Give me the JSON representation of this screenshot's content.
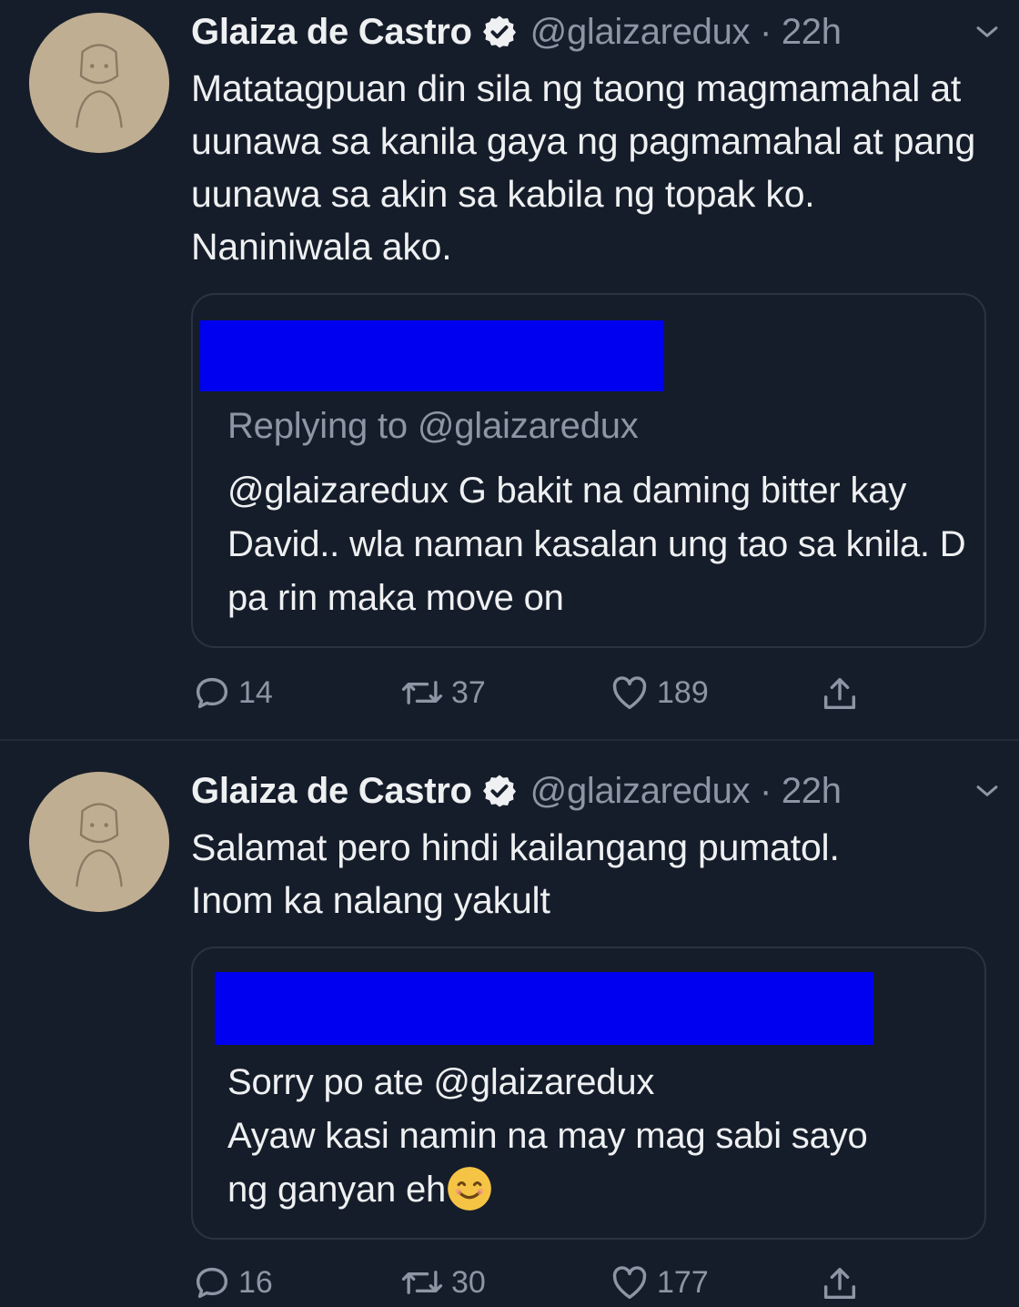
{
  "tweets": [
    {
      "name": "Glaiza de Castro",
      "handle": "@glaizaredux · 22h",
      "text": "Matatagpuan din sila ng taong magmamahal at uunawa sa kanila gaya ng pagmamahal at pang uunawa sa akin sa kabila ng topak ko. Naniniwala ako.",
      "quote": {
        "replying": "Replying to @glaizaredux",
        "text": "@glaizaredux  G bakit na daming bitter kay David.. wla naman kasalan ung tao sa knila. D pa rin maka move on"
      },
      "replies": "14",
      "retweets": "37",
      "likes": "189"
    },
    {
      "name": "Glaiza de Castro",
      "handle": "@glaizaredux · 22h",
      "text_line1": "Salamat pero hindi kailangang pumatol.",
      "text_line2": "Inom ka nalang yakult",
      "quote": {
        "line1": "Sorry po ate @glaizaredux",
        "line2": "Ayaw kasi namin na may mag sabi sayo",
        "line3": "ng ganyan eh",
        "emoji": "smiling-face-emoji"
      },
      "replies": "16",
      "retweets": "30",
      "likes": "177"
    }
  ],
  "colors": {
    "background": "#161d2a",
    "secondary_text": "#8c96a4",
    "redaction": "#0000f0"
  },
  "icons": [
    "verified-badge-icon",
    "chevron-down-icon",
    "reply-icon",
    "retweet-icon",
    "like-icon",
    "share-icon"
  ]
}
